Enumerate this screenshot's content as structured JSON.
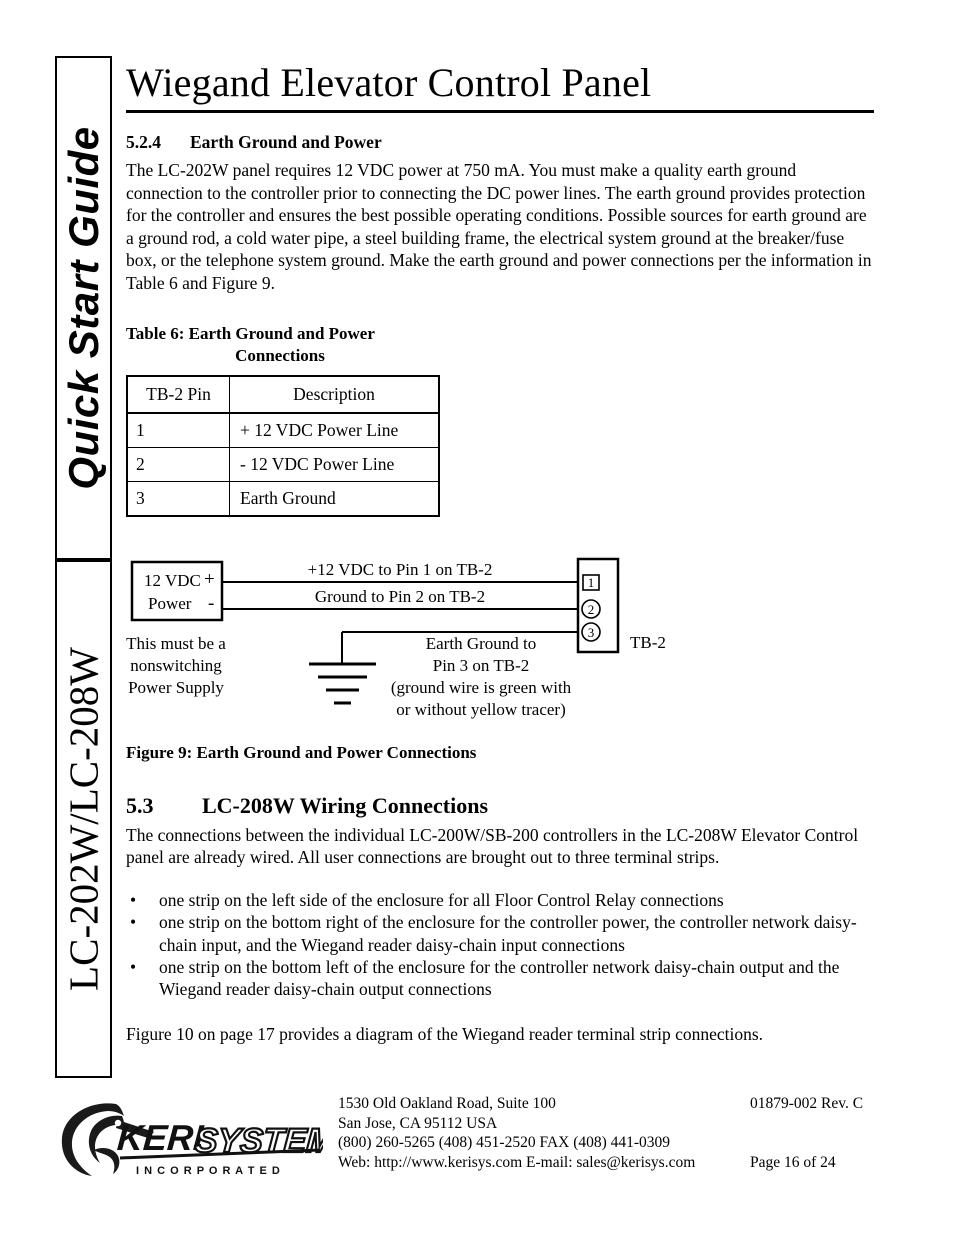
{
  "sidebar": {
    "tab_top_label": "Quick Start Guide",
    "tab_bottom_label": "LC-202W/LC-208W"
  },
  "header": {
    "title": "Wiegand Elevator Control Panel"
  },
  "section_524": {
    "number": "5.2.4",
    "title": "Earth Ground and Power",
    "paragraph": "The LC-202W panel requires 12 VDC power at 750 mA. You must make a quality earth ground connection to the controller prior to connecting the DC power lines. The earth ground provides protection for the controller and ensures the best possible operating conditions. Possible sources for earth ground are a ground rod, a cold water pipe, a steel building frame, the electrical system ground at the breaker/fuse box, or the telephone system ground. Make the earth ground and power connections per the information in Table 6 and Figure 9."
  },
  "table6": {
    "caption_line1": "Table 6: Earth Ground and Power",
    "caption_line2": "Connections",
    "headers": [
      "TB-2 Pin",
      "Description"
    ],
    "rows": [
      [
        "1",
        "+ 12 VDC Power Line"
      ],
      [
        "2",
        "- 12 VDC Power Line"
      ],
      [
        "3",
        "Earth Ground"
      ]
    ]
  },
  "figure9": {
    "caption": "Figure 9: Earth Ground and Power Connections",
    "supply_line1": "12 VDC",
    "supply_plus": "+",
    "supply_line2": "Power",
    "supply_minus": "-",
    "wire1_label": "+12 VDC to Pin 1 on TB-2",
    "wire2_label": "Ground to Pin 2 on TB-2",
    "ground_label_line1": "Earth Ground to",
    "ground_label_line2": "Pin 3 on TB-2",
    "ground_label_line3": "(ground wire is green with",
    "ground_label_line4": "or without yellow tracer)",
    "terminal_label": "TB-2",
    "pin1": "1",
    "pin2": "2",
    "pin3": "3",
    "note_line1": "This must be a",
    "note_line2": "nonswitching",
    "note_line3": "Power Supply"
  },
  "section_53": {
    "number": "5.3",
    "title": "LC-208W Wiring Connections",
    "paragraph": "The connections between the individual LC-200W/SB-200 controllers in the LC-208W Elevator Control panel are already wired. All user connections are brought out to three terminal strips.",
    "bullet_marker": "•",
    "bullets": [
      "one strip on the left side of the enclosure for all Floor Control Relay connections",
      "one strip on the bottom right of the enclosure for the controller power, the controller network daisy-chain input, and the Wiegand reader daisy-chain input connections",
      "one strip on the bottom left of the enclosure for the controller network daisy-chain output and the Wiegand reader daisy-chain output connections"
    ],
    "closing": "Figure 10 on page 17 provides a diagram of the Wiegand reader terminal strip connections."
  },
  "footer": {
    "logo_keri": "KERI",
    "logo_systems": "SYSTEMS",
    "logo_incorporated": "I N C O R P O R A T E D",
    "address_line1": "1530 Old Oakland Road, Suite 100",
    "address_line2": "San Jose, CA  95112   USA",
    "address_line3": "(800) 260-5265  (408) 451-2520  FAX (408) 441-0309",
    "address_line4": "Web: http://www.kerisys.com  E-mail: sales@kerisys.com",
    "doc_number": "01879-002 Rev. C",
    "page_number": "Page 16 of 24"
  }
}
